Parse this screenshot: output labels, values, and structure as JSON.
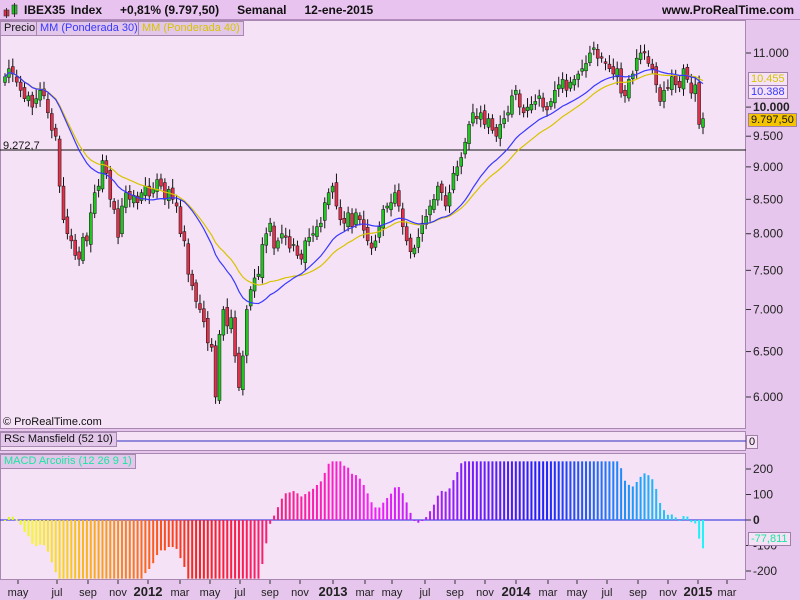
{
  "header": {
    "symbol": "IBEX35 Index",
    "change": "+0,81% (9.797,50)",
    "period": "Semanal",
    "date": "12-ene-2015",
    "site": "www.ProRealTime.com"
  },
  "legend": {
    "price": "Precio",
    "ma30": "MM (Ponderada 30)",
    "ma40": "MM (Ponderada 40)"
  },
  "colors": {
    "up": "#22c422",
    "down": "#e0304a",
    "ma30": "#3838ff",
    "ma40": "#d6c400",
    "background": "#f6e2f6",
    "last": "#f5c400",
    "macd_last": "#19e6a0"
  },
  "price_axis": {
    "scale": "log",
    "ticks": [
      "11.000",
      "10.000",
      "9.500",
      "9.000",
      "8.500",
      "8.000",
      "7.500",
      "7.000",
      "6.500",
      "6.000"
    ],
    "tick_values": [
      11000,
      10000,
      9500,
      9000,
      8500,
      8000,
      7500,
      7000,
      6500,
      6000
    ],
    "ma40_value": "10.455",
    "ma30_value": "10.388",
    "last_value": "9.797,50"
  },
  "hline": {
    "label": "9.272,7",
    "value": 9272.7
  },
  "copyright": "© ProRealTime.com",
  "rsc": {
    "label": "RSc Mansfield (52 10)",
    "value": "0"
  },
  "macd": {
    "label": "MACD Arcoiris (12 26 9 1)",
    "ticks": [
      "200",
      "100",
      "0",
      "-100",
      "-200"
    ],
    "tick_values": [
      200,
      100,
      0,
      -100,
      -200
    ],
    "last_value": "-77,811"
  },
  "x_axis": [
    {
      "l": "may",
      "b": false
    },
    {
      "l": "jul",
      "b": false
    },
    {
      "l": "sep",
      "b": false
    },
    {
      "l": "nov",
      "b": false
    },
    {
      "l": "2012",
      "b": true
    },
    {
      "l": "mar",
      "b": false
    },
    {
      "l": "may",
      "b": false
    },
    {
      "l": "jul",
      "b": false
    },
    {
      "l": "sep",
      "b": false
    },
    {
      "l": "nov",
      "b": false
    },
    {
      "l": "2013",
      "b": true
    },
    {
      "l": "mar",
      "b": false
    },
    {
      "l": "may",
      "b": false
    },
    {
      "l": "jul",
      "b": false
    },
    {
      "l": "sep",
      "b": false
    },
    {
      "l": "nov",
      "b": false
    },
    {
      "l": "2014",
      "b": true
    },
    {
      "l": "mar",
      "b": false
    },
    {
      "l": "may",
      "b": false
    },
    {
      "l": "jul",
      "b": false
    },
    {
      "l": "sep",
      "b": false
    },
    {
      "l": "nov",
      "b": false
    },
    {
      "l": "2015",
      "b": true
    },
    {
      "l": "mar",
      "b": false
    }
  ],
  "chart_data": {
    "type": "candlestick",
    "frequency": "weekly",
    "period": [
      "abr-2011",
      "12-ene-2015"
    ],
    "indicators": [
      "WMA 30",
      "WMA 40",
      "MACD 12 26 9"
    ],
    "closes": [
      10550,
      10700,
      10600,
      10450,
      10300,
      10150,
      10200,
      10000,
      10150,
      10300,
      10200,
      9900,
      9600,
      9500,
      8700,
      8200,
      8000,
      7900,
      7700,
      7650,
      7950,
      7900,
      8300,
      8600,
      8700,
      9100,
      8900,
      8500,
      8350,
      7950,
      8400,
      8600,
      8500,
      8560,
      8450,
      8600,
      8700,
      8550,
      8650,
      8800,
      8700,
      8500,
      8650,
      8500,
      8400,
      8000,
      7900,
      7450,
      7300,
      7100,
      7000,
      6850,
      6600,
      6550,
      6000,
      6700,
      7000,
      6800,
      6900,
      6450,
      6100,
      6450,
      7000,
      7250,
      7400,
      7450,
      7850,
      8000,
      8150,
      7800,
      7900,
      8000,
      7950,
      7800,
      7850,
      7700,
      7650,
      7900,
      7950,
      8000,
      8100,
      8150,
      8450,
      8600,
      8700,
      8400,
      8200,
      8150,
      8300,
      8100,
      8300,
      8200,
      8050,
      7900,
      7800,
      7900,
      8100,
      8350,
      8400,
      8450,
      8600,
      8400,
      8100,
      7900,
      7750,
      7800,
      7950,
      8150,
      8250,
      8400,
      8500,
      8700,
      8600,
      8400,
      8600,
      8900,
      9000,
      9150,
      9400,
      9700,
      9900,
      9800,
      9900,
      9700,
      9800,
      9600,
      9500,
      9700,
      9800,
      9900,
      10200,
      10300,
      10000,
      9900,
      10000,
      10050,
      10100,
      10200,
      10000,
      9950,
      10100,
      10300,
      10400,
      10500,
      10300,
      10450,
      10500,
      10600,
      10700,
      10800,
      11000,
      11100,
      10900,
      10900,
      10800,
      10700,
      10600,
      10700,
      10250,
      10200,
      10500,
      10600,
      10900,
      11000,
      11000,
      10800,
      10700,
      10400,
      10100,
      10300,
      10350,
      10550,
      10400,
      10350,
      10700,
      10500,
      10250,
      10400,
      9700,
      9797.5
    ]
  }
}
